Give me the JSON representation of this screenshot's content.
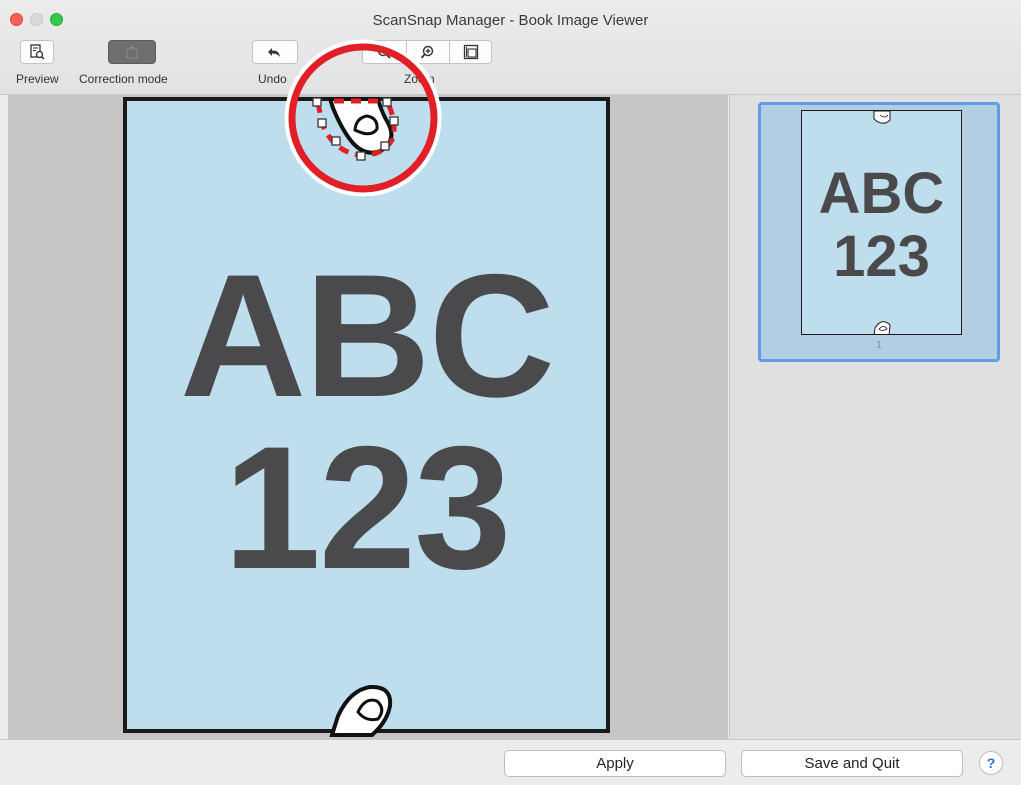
{
  "window": {
    "title": "ScanSnap Manager - Book Image Viewer"
  },
  "toolbar": {
    "preview_label": "Preview",
    "correction_mode_label": "Correction mode",
    "undo_label": "Undo",
    "zoom_label": "Zoom",
    "preview_icon": "preview-icon",
    "correction_icon": "correction-mode-icon",
    "undo_icon": "undo-arrow-icon",
    "zoom_in_icon": "zoom-in-icon",
    "fit_icon": "fit-page-icon"
  },
  "page": {
    "line1": "ABC",
    "line2": "123"
  },
  "thumbnail": {
    "line1": "ABC",
    "line2": "123",
    "page_number": "1"
  },
  "buttons": {
    "apply": "Apply",
    "save_quit": "Save and Quit",
    "help": "?"
  },
  "colors": {
    "page_background": "#bfdeed",
    "highlight_circle": "#e21f26",
    "selection_border": "#5e9ee0"
  }
}
